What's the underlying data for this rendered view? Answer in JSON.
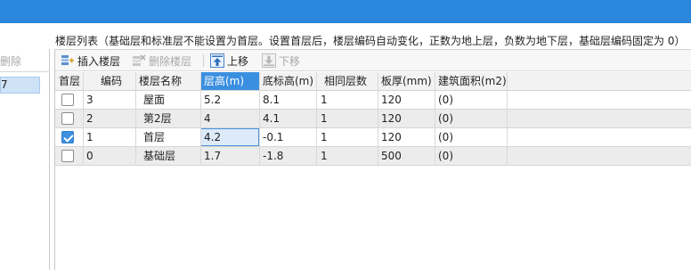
{
  "description": "楼层列表（基础层和标准层不能设置为首层。设置首层后，楼层编码自动变化，正数为地上层，负数为地下层，基础层编码固定为 0）",
  "left_panel": {
    "delete_label": "删除",
    "selected_text": "7"
  },
  "toolbar": {
    "insert_label": "插入楼层",
    "delete_label": "删除楼层",
    "move_up_label": "上移",
    "move_down_label": "下移"
  },
  "table": {
    "headers": [
      "首层",
      "编码",
      "楼层名称",
      "层高(m)",
      "底标高(m)",
      "相同层数",
      "板厚(mm)",
      "建筑面积(m2)"
    ],
    "rows": [
      {
        "first_floor": false,
        "code": "3",
        "name": "屋面",
        "height": "5.2",
        "base_elev": "8.1",
        "same_count": "1",
        "thickness": "120",
        "area": "(0)"
      },
      {
        "first_floor": false,
        "code": "2",
        "name": "第2层",
        "height": "4",
        "base_elev": "4.1",
        "same_count": "1",
        "thickness": "120",
        "area": "(0)"
      },
      {
        "first_floor": true,
        "code": "1",
        "name": "首层",
        "height": "4.2",
        "base_elev": "-0.1",
        "same_count": "1",
        "thickness": "120",
        "area": "(0)"
      },
      {
        "first_floor": false,
        "code": "0",
        "name": "基础层",
        "height": "1.7",
        "base_elev": "-1.8",
        "same_count": "1",
        "thickness": "500",
        "area": "(0)"
      }
    ]
  },
  "colors": {
    "title_bar": "#2a87dc",
    "active_header": "#3b8fe0",
    "checkbox_on": "#3d8fe0"
  }
}
